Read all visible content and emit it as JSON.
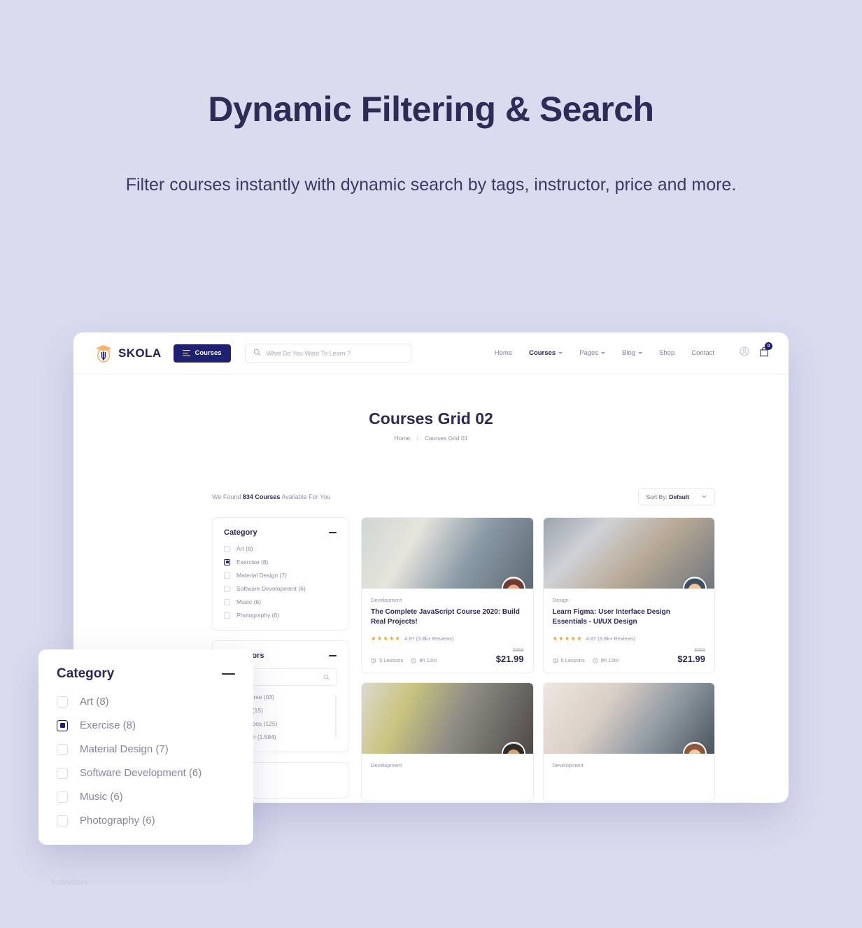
{
  "hero": {
    "title": "Dynamic Filtering & Search",
    "subtitle": "Filter courses instantly with dynamic search by tags, instructor, price and more."
  },
  "colors": {
    "page_background": "#d9dbef",
    "brand_navy": "#1f2071",
    "brand_orange": "#f5a623",
    "heading": "#2e2c55",
    "muted_text": "#8e8caa"
  },
  "header": {
    "logo_text": "SKOLA",
    "logo_icon": "graduation-cap-pencil-icon",
    "courses_button": {
      "label": "Courses",
      "icon": "hamburger-icon"
    },
    "search": {
      "placeholder": "What Do You Want To Learn ?",
      "value": "",
      "icon": "search-icon"
    },
    "nav": [
      {
        "label": "Home",
        "has_caret": false,
        "active": false
      },
      {
        "label": "Courses",
        "has_caret": true,
        "active": true
      },
      {
        "label": "Pages",
        "has_caret": true,
        "active": false
      },
      {
        "label": "Blog",
        "has_caret": true,
        "active": false
      },
      {
        "label": "Shop",
        "has_caret": false,
        "active": false
      },
      {
        "label": "Contact",
        "has_caret": false,
        "active": false
      }
    ],
    "account_icon": "user-circle-icon",
    "cart_icon": "cart-bag-icon",
    "cart_count": "0"
  },
  "page": {
    "title": "Courses Grid 02",
    "breadcrumb": {
      "home": "Home",
      "separator": "/",
      "current": "Courses Grid 01"
    },
    "results_prefix": "We Found",
    "results_count": "834 Courses",
    "results_suffix": "Available For You",
    "sort": {
      "label": "Sort By:",
      "value": "Default",
      "icon": "chevron-down-icon"
    }
  },
  "sidebar": {
    "category_panel": {
      "title": "Category",
      "collapse_icon": "minus-icon",
      "options": [
        {
          "label": "Art (8)",
          "checked": false
        },
        {
          "label": "Exercise (8)",
          "checked": true
        },
        {
          "label": "Material Design (7)",
          "checked": false
        },
        {
          "label": "Software Development (6)",
          "checked": false
        },
        {
          "label": "Music (6)",
          "checked": false
        },
        {
          "label": "Photography (6)",
          "checked": false
        }
      ]
    },
    "instructors_panel": {
      "title": "Instructors",
      "collapse_icon": "minus-icon",
      "search": {
        "placeholder": "",
        "value": "",
        "icon": "search-icon"
      },
      "options": [
        {
          "label": "Converse (03)",
          "checked": false
        },
        {
          "label": "Rand (15)",
          "checked": false
        },
        {
          "label": "Villalobos (125)",
          "checked": false
        },
        {
          "label": "William (1.584)",
          "checked": false
        }
      ]
    },
    "cut_label": "Instructors"
  },
  "courses": [
    {
      "tag": "Development",
      "title": "The Complete JavaScript Course 2020: Build Real Projects!",
      "stars": "★★★★★",
      "rating": "4.87 (3.8k+ Reviews)",
      "lessons": "5 Lessons",
      "duration": "8h 12m",
      "old_price": "$959",
      "price": "$21.99",
      "lessons_icon": "book-icon",
      "duration_icon": "clock-icon"
    },
    {
      "tag": "Design",
      "title": "Learn Figma: User Interface Design Essentials - UI/UX Design",
      "stars": "★★★★★",
      "rating": "4.87 (3.8k+ Reviews)",
      "lessons": "5 Lessons",
      "duration": "8h 12m",
      "old_price": "$959",
      "price": "$21.99",
      "lessons_icon": "book-icon",
      "duration_icon": "clock-icon"
    },
    {
      "tag": "Development",
      "title": "",
      "stars": "",
      "rating": "",
      "lessons": "",
      "duration": "",
      "old_price": "",
      "price": "",
      "lessons_icon": "book-icon",
      "duration_icon": "clock-icon"
    },
    {
      "tag": "Development",
      "title": "",
      "stars": "",
      "rating": "",
      "lessons": "",
      "duration": "",
      "old_price": "",
      "price": "",
      "lessons_icon": "book-icon",
      "duration_icon": "clock-icon"
    }
  ],
  "zoom_popup": {
    "title": "Category",
    "collapse_icon": "minus-icon",
    "options": [
      {
        "label": "Art (8)",
        "checked": false
      },
      {
        "label": "Exercise (8)",
        "checked": true
      },
      {
        "label": "Material Design (7)",
        "checked": false
      },
      {
        "label": "Software Development (6)",
        "checked": false
      },
      {
        "label": "Music (6)",
        "checked": false
      },
      {
        "label": "Photography (6)",
        "checked": false
      }
    ]
  }
}
